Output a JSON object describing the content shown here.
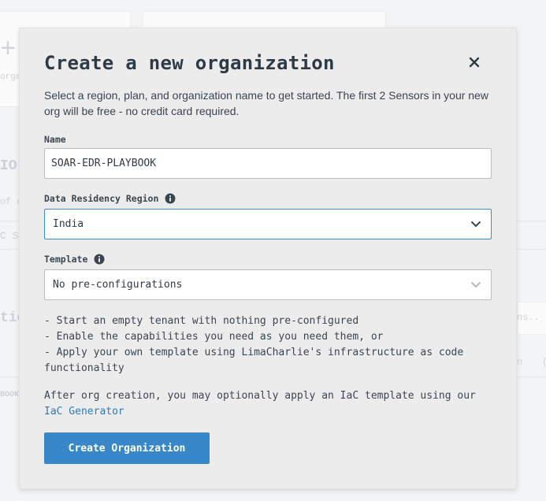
{
  "background": {
    "card_label": "orga",
    "section_heading_1": "IO",
    "section_subtext_1": "of c",
    "chip_text": "C S",
    "section_heading_2": "tio",
    "right_hint": "ns..",
    "right_meta_1": "n",
    "right_meta_2": "(",
    "row_text": "BOOK"
  },
  "modal": {
    "title": "Create a new organization",
    "close_icon": "close-icon",
    "intro": "Select a region, plan, and organization name to get started. The first 2 Sensors in your new org will be free - no credit card required.",
    "name_label": "Name",
    "name_value": "SOAR-EDR-PLAYBOOK",
    "region_label": "Data Residency Region",
    "region_value": "India",
    "template_label": "Template",
    "template_value": "No pre-configurations",
    "template_notes": [
      "- Start an empty tenant with nothing pre-configured",
      "- Enable the capabilities you need as you need them, or",
      "- Apply your own template using LimaCharlie's infrastructure as code functionality"
    ],
    "after_text": "After org creation, you may optionally apply an IaC template using our ",
    "after_link": "IaC Generator",
    "submit_label": "Create Organization",
    "info_icon": "info-icon",
    "chevron_icon": "chevron-down-icon"
  },
  "colors": {
    "accent": "#3787c9",
    "link": "#2d7ab8",
    "modal_bg": "#ececed",
    "page_bg": "#f3f4f5"
  }
}
